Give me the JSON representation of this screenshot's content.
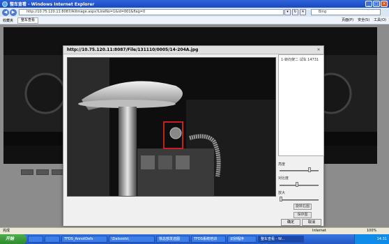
{
  "window": {
    "title": "整车查看 - Windows Internet Explorer"
  },
  "address": {
    "url": "http://10.75.120.11:8087/AllImage.aspx?LineNo=1&id=001&flag=0",
    "search_text": "Bing"
  },
  "favbar": {
    "favorites_label": "收藏夹",
    "tab_label": "整车查看"
  },
  "commandbar": {
    "page": "页面(P)",
    "safety": "安全(S)",
    "tools": "工具(O)"
  },
  "dialog": {
    "title": "http://10.75.120.11:8087/File/131110/0005/14-204A.jpg",
    "panel_text": "1-转向架二 试车 14731",
    "brightness_label": "亮度",
    "contrast_label": "对比度",
    "zoom_label": "放大",
    "rotate_btn": "旋转右图",
    "save_btn": "保存图",
    "ok_btn": "确定",
    "cancel_btn": "取消",
    "close_glyph": "✕"
  },
  "statusbar": {
    "left": "完成",
    "zone": "Internet",
    "zoom": "100%"
  },
  "taskbar": {
    "start": "开始",
    "tasks": [
      "",
      "",
      "TFDS_AnnotDefs",
      "\\Dalsoots\\",
      "铁总部发选图",
      "TFDS系统培训",
      "识别程序",
      "整车查看 - W..."
    ],
    "clock": "14:31"
  },
  "colors": {
    "titlebar": "#2f63d8",
    "taskbar": "#2358c8",
    "start": "#3a9a3a",
    "marker": "#c81e1e"
  }
}
